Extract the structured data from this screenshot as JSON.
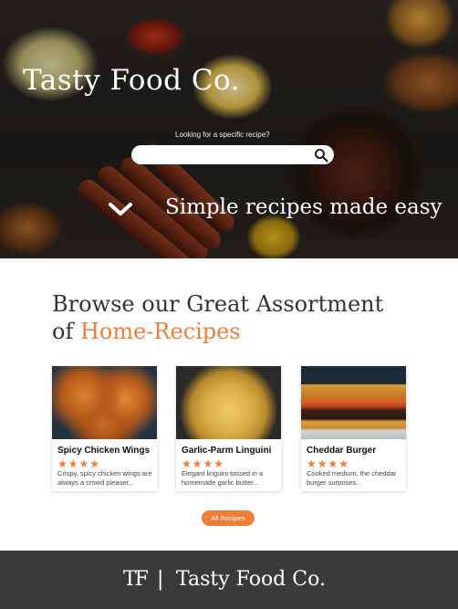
{
  "hero": {
    "title": "Tasty Food Co.",
    "search_caption": "Looking for a specific recipe?",
    "search_placeholder": "",
    "tagline": "Simple recipes made easy"
  },
  "browse": {
    "heading_line1": "Browse our Great Assortment",
    "heading_prefix": "of ",
    "heading_accent": "Home-Recipes"
  },
  "recipes": [
    {
      "name": "Spicy Chicken Wings",
      "rating": 4,
      "stars": "★★★★",
      "description": "Crispy, spicy chicken wings are always a crowd pleaser...",
      "photo": "chicken-wings-photo"
    },
    {
      "name": "Garlic-Parm Linguini",
      "rating": 4,
      "stars": "★★★★",
      "description": "Elegant linguini tossed in a homemade garlic butter...",
      "photo": "linguini-photo"
    },
    {
      "name": "Cheddar Burger",
      "rating": 4,
      "stars": "★★★★",
      "description": "Cooked medium, the cheddar burger surprises...",
      "photo": "burger-photo"
    }
  ],
  "all_recipes_label": "All Recipes",
  "footer": {
    "logo_mark": "TF",
    "separator": "|",
    "brand_name": "Tasty Food Co."
  },
  "colors": {
    "accent": "#f07d36",
    "footer_bg": "#3a3a3a",
    "heading_text": "#333333"
  }
}
